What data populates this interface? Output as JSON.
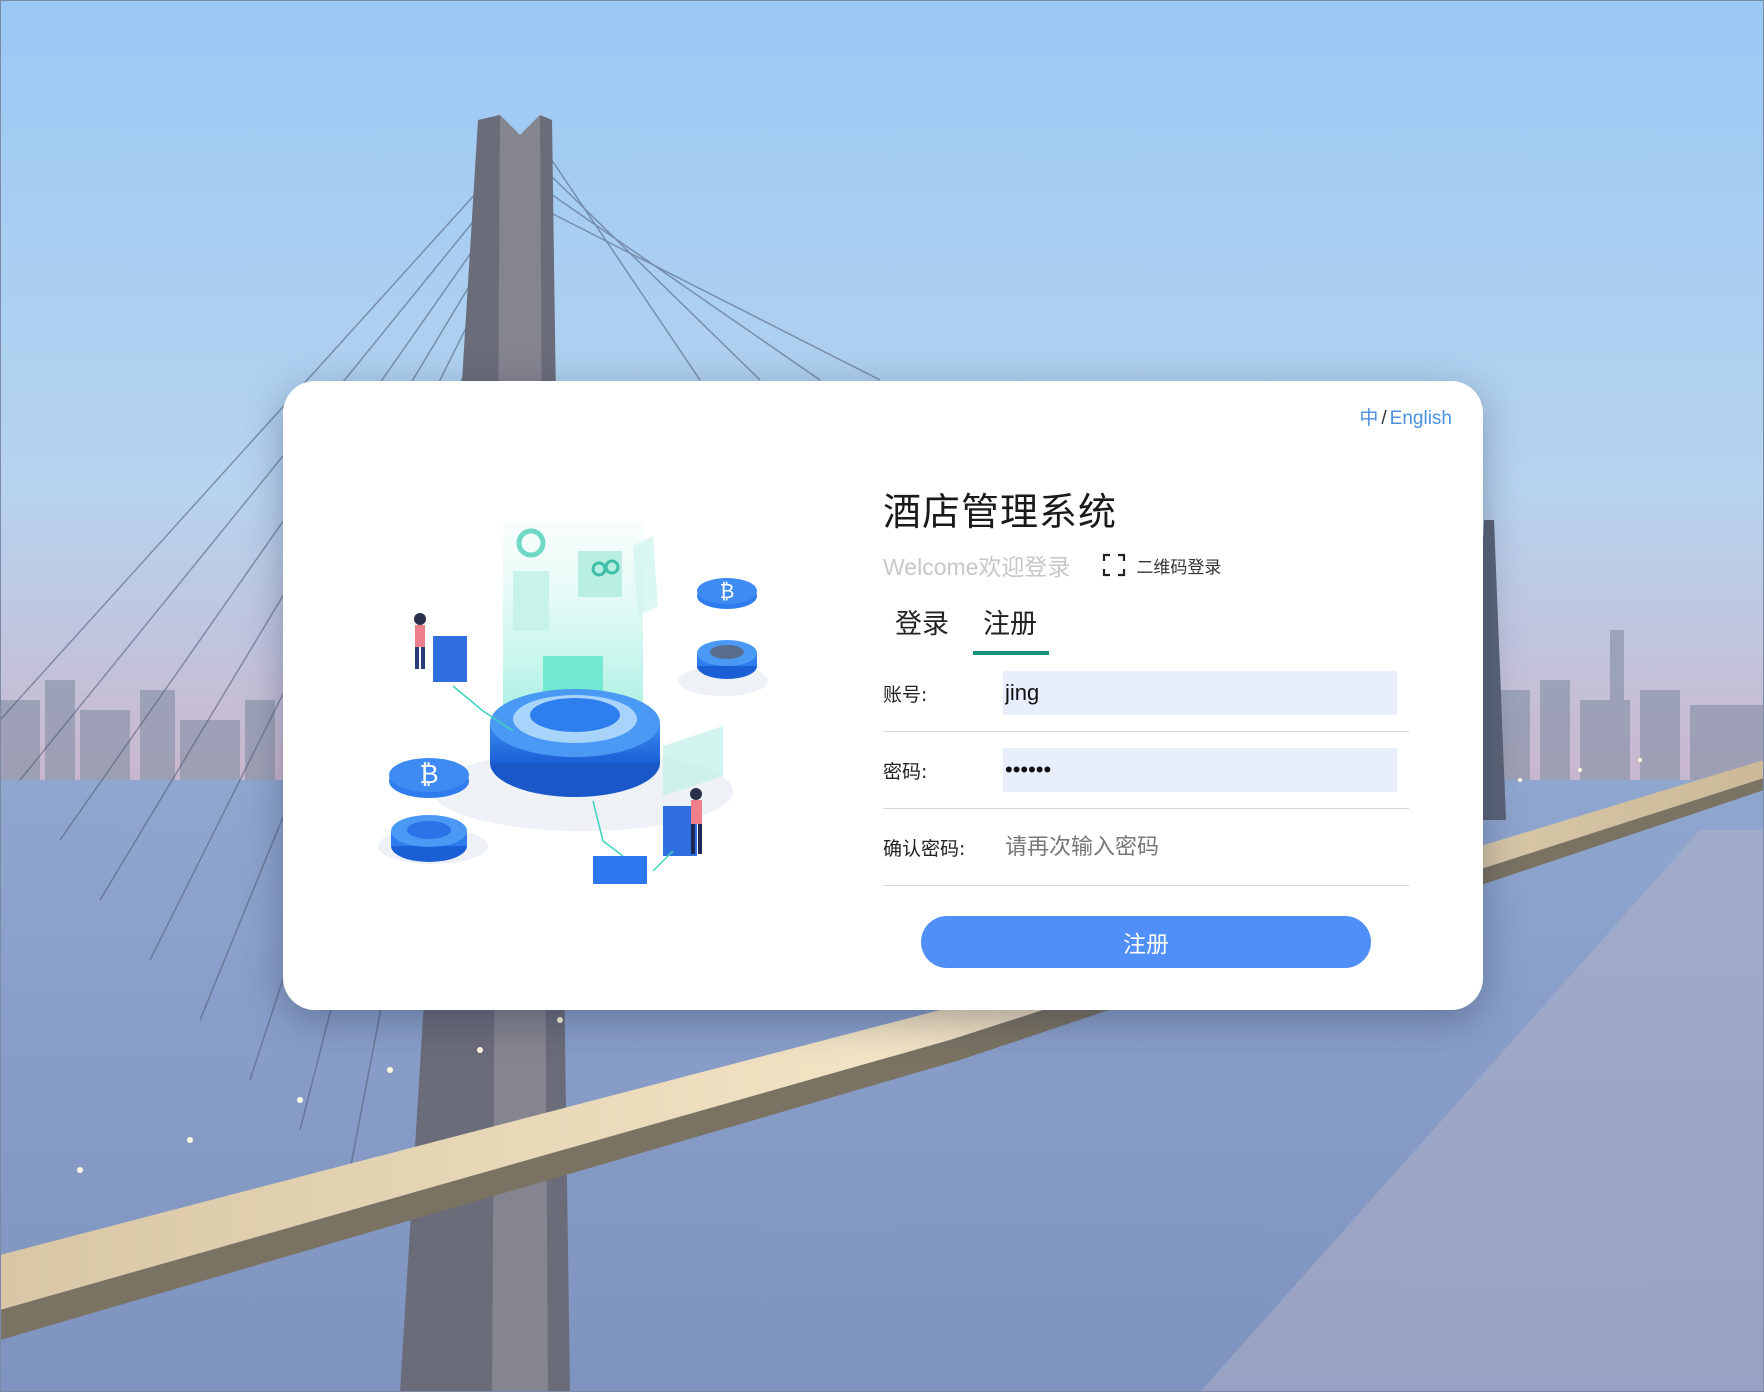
{
  "lang_switch": {
    "zh": "中",
    "separator": "/",
    "en": "English"
  },
  "title": "酒店管理系统",
  "welcome": "Welcome欢迎登录",
  "qr_login": {
    "icon": "scan-frame-icon",
    "label": "二维码登录"
  },
  "tabs": [
    {
      "label": "登录",
      "active": false
    },
    {
      "label": "注册",
      "active": true
    }
  ],
  "form": {
    "account": {
      "label": "账号:",
      "value": "jing"
    },
    "password": {
      "label": "密码:",
      "value": "••••••"
    },
    "confirm": {
      "label": "确认密码:",
      "placeholder": "请再次输入密码"
    }
  },
  "submit_label": "注册",
  "colors": {
    "accent": "#4f8ff7",
    "tab_underline": "#16907f",
    "lang_link": "#4a90e2",
    "input_fill": "#e8eefb"
  }
}
